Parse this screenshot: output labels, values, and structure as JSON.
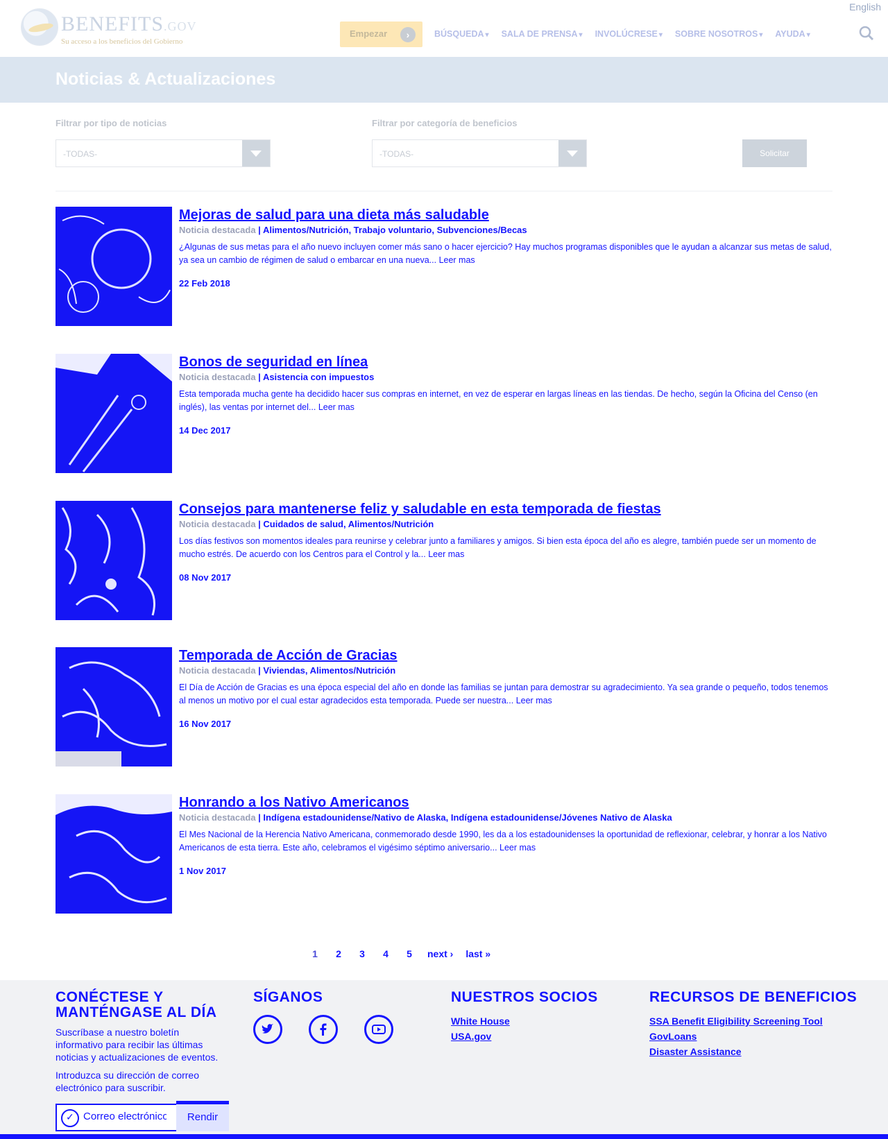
{
  "header": {
    "language_link": "English",
    "logo_word": "BENEFITS",
    "logo_gov": ".GOV",
    "logo_tagline": "Su acceso a los beneficios del Gobierno",
    "start_button": "Empezar",
    "nav": [
      {
        "label": "BÚSQUEDA"
      },
      {
        "label": "SALA DE PRENSA"
      },
      {
        "label": "INVOLÚCRESE"
      },
      {
        "label": "SOBRE NOSOTROS"
      },
      {
        "label": "AYUDA"
      }
    ]
  },
  "page_title": "Noticias & Actualizaciones",
  "filters": {
    "news_type_label": "Filtrar por tipo de noticias",
    "news_type_value": "-TODAS-",
    "category_label": "Filtrar por categoría de beneficios",
    "category_value": "-TODAS-",
    "submit_label": "Solicitar"
  },
  "articles": [
    {
      "title": "Mejoras de salud para una dieta más saludable",
      "featured": "Noticia destacada",
      "categories": "Alimentos/Nutrición, Trabajo voluntario, Subvenciones/Becas",
      "description": "¿Algunas de sus metas para el año nuevo incluyen comer más sano o hacer ejercicio? Hay muchos programas disponibles que le ayudan a alcanzar sus metas de salud, ya sea un cambio de régimen de salud o embarcar en una nueva...",
      "more": "Leer mas",
      "date": "22 Feb 2018"
    },
    {
      "title": "Bonos de seguridad en línea",
      "featured": "Noticia destacada",
      "categories": "Asistencia con impuestos",
      "description": "Esta temporada mucha gente ha decidido hacer sus compras en internet, en vez de esperar en largas líneas en las tiendas. De hecho, según la Oficina del Censo (en inglés), las ventas por internet del...",
      "more": "Leer mas",
      "date": "14 Dec 2017"
    },
    {
      "title": "Consejos para mantenerse feliz y saludable en esta temporada de fiestas",
      "featured": "Noticia destacada",
      "categories": "Cuidados de salud, Alimentos/Nutrición",
      "description": "Los días festivos son momentos ideales para reunirse y celebrar junto a familiares y amigos. Si bien esta época del año es alegre, también puede ser un momento de mucho estrés. De acuerdo con los Centros para el Control y la...",
      "more": "Leer mas",
      "date": "08 Nov 2017"
    },
    {
      "title": "Temporada de Acción de Gracias",
      "featured": "Noticia destacada",
      "categories": "Viviendas, Alimentos/Nutrición",
      "description": "El Día de Acción de Gracias es una época especial del año en donde las familias se juntan para demostrar su agradecimiento. Ya sea grande o pequeño, todos tenemos al menos un motivo por el cual estar agradecidos esta temporada. Puede ser nuestra...",
      "more": "Leer mas",
      "date": "16 Nov 2017"
    },
    {
      "title": "Honrando a los Nativo Americanos",
      "featured": "Noticia destacada",
      "categories": "Indígena estadounidense/Nativo de Alaska, Indígena estadounidense/Jóvenes Nativo de Alaska",
      "description": "El Mes Nacional de la Herencia Nativo Americana, conmemorado desde 1990, les da a los estadounidenses la oportunidad de reflexionar, celebrar, y honrar a los Nativo Americanos de esta tierra. Este año, celebramos el vigésimo séptimo aniversario...",
      "more": "Leer mas",
      "date": "1 Nov 2017"
    }
  ],
  "pager": [
    "1",
    "2",
    "3",
    "4",
    "5",
    "next ›",
    "last »"
  ],
  "footer": {
    "connect_title": "CONÉCTESE Y MANTÉNGASE AL DÍA",
    "connect_text": "Suscríbase a nuestro boletín informativo para recibir las últimas noticias y actualizaciones de eventos.",
    "email_prompt": "Introduzca su dirección de correo electrónico para suscribir.",
    "email_placeholder": "Correo electrónico",
    "submit_label": "Rendir",
    "follow_title": "SÍGANOS",
    "partners_title": "NUESTROS SOCIOS",
    "partners": [
      "White House",
      "USA.gov"
    ],
    "resources_title": "RECURSOS DE BENEFICIOS",
    "resources": [
      "SSA Benefit Eligibility Screening Tool",
      "GovLoans",
      "Disaster Assistance"
    ]
  }
}
